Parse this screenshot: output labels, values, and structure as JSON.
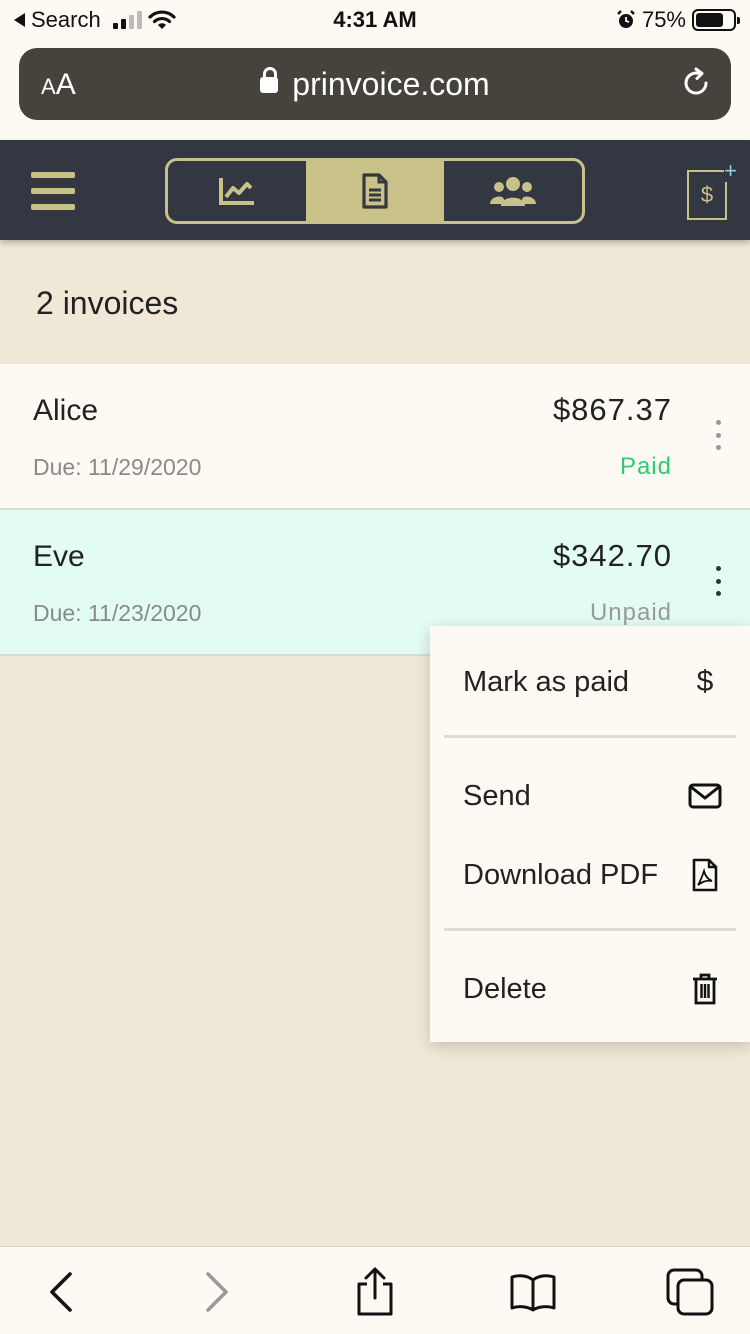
{
  "status_bar": {
    "back_label": "Search",
    "time": "4:31 AM",
    "battery": "75%",
    "battery_level": 0.75
  },
  "browser": {
    "text_size_label_small": "A",
    "text_size_label_large": "A",
    "url": "prinvoice.com"
  },
  "app_header": {
    "tabs": [
      {
        "icon": "chart-icon",
        "active": false
      },
      {
        "icon": "invoice-icon",
        "active": true
      },
      {
        "icon": "clients-icon",
        "active": false
      }
    ],
    "new_invoice_symbol": "$",
    "new_invoice_plus": "+",
    "accent_color": "#c8c289",
    "bar_color": "#323741"
  },
  "summary": "2 invoices",
  "invoices": [
    {
      "name": "Alice",
      "due": "Due: 11/29/2020",
      "amount": "$867.37",
      "status": "Paid",
      "status_color": "#2ecc71"
    },
    {
      "name": "Eve",
      "due": "Due: 11/23/2020",
      "amount": "$342.70",
      "status": "Unpaid",
      "status_color": "#9a9a9a"
    }
  ],
  "menu": {
    "items": [
      {
        "label": "Mark as paid",
        "icon": "dollar-icon",
        "glyph": "$"
      },
      {
        "label": "Send",
        "icon": "mail-icon"
      },
      {
        "label": "Download PDF",
        "icon": "pdf-icon"
      },
      {
        "label": "Delete",
        "icon": "trash-icon"
      }
    ]
  },
  "toolbar": {
    "icons": [
      "back-icon",
      "forward-icon",
      "share-icon",
      "bookmarks-icon",
      "tabs-icon"
    ]
  }
}
